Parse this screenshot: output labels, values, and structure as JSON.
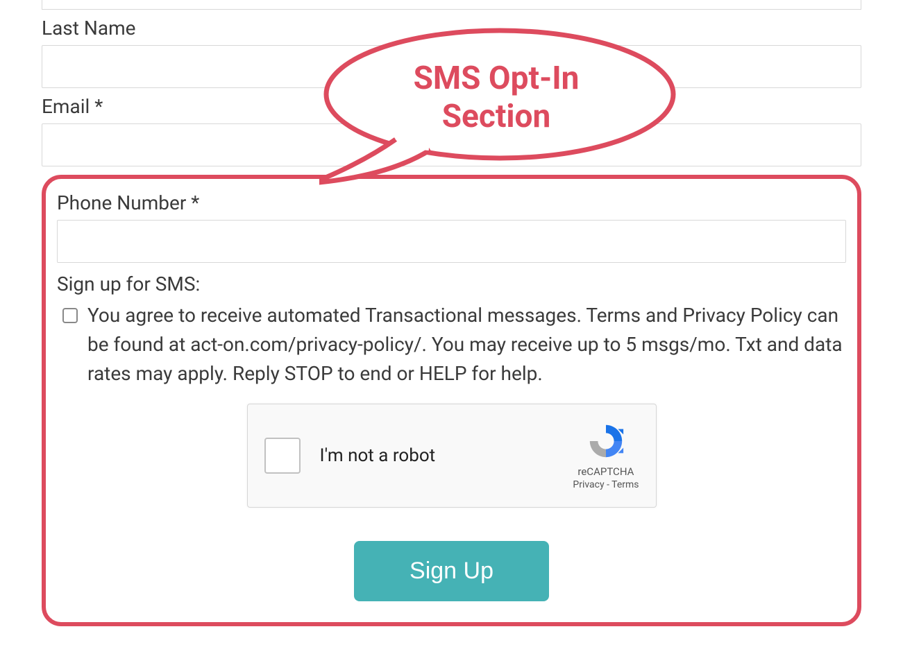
{
  "form": {
    "last_name_label": "Last Name",
    "email_label": "Email *",
    "phone_label": "Phone Number *",
    "sms_signup_label": "Sign up for SMS:",
    "consent_text": "You agree to receive automated Transactional messages. Terms and Privacy Policy can be found at act-on.com/privacy-policy/. You may receive up to 5 msgs/mo. Txt and data rates may apply. Reply STOP to end or HELP for help.",
    "submit_label": "Sign Up"
  },
  "recaptcha": {
    "label": "I'm not a robot",
    "brand": "reCAPTCHA",
    "links": "Privacy  -  Terms"
  },
  "callout": {
    "line1": "SMS Opt-In",
    "line2": "Section"
  }
}
